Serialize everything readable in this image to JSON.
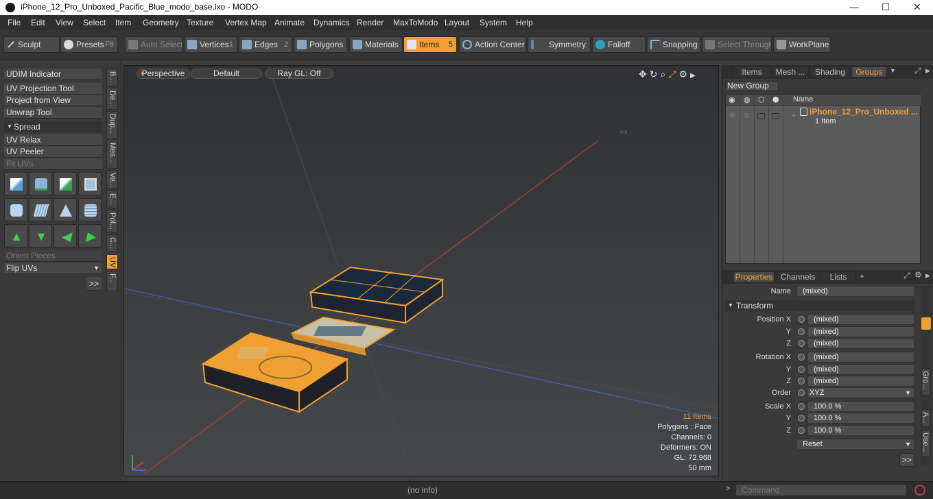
{
  "window": {
    "title": "iPhone_12_Pro_Unboxed_Pacific_Blue_modo_base.lxo - MODO",
    "minimize": "—",
    "maximize": "☐",
    "close": "✕"
  },
  "menu": [
    "File",
    "Edit",
    "View",
    "Select",
    "Item",
    "Geometry",
    "Texture",
    "Vertex Map",
    "Animate",
    "Dynamics",
    "Render",
    "MaxToModo",
    "Layout",
    "System",
    "Help"
  ],
  "toolbar": {
    "sculpt": "Sculpt",
    "presets": "Presets",
    "presets_key": "F6",
    "auto_select": "Auto Select",
    "vertices": "Vertices",
    "vertices_key": "1",
    "edges": "Edges",
    "edges_key": "2",
    "polygons": "Polygons",
    "materials": "Materials",
    "items": "Items",
    "items_key": "5",
    "action_center": "Action Center",
    "symmetry": "Symmetry",
    "falloff": "Falloff",
    "snapping": "Snapping",
    "select_through": "Select Through",
    "workplane": "WorkPlane"
  },
  "leftpanel": {
    "udim": "UDIM Indicator",
    "uv_projection": "UV Projection Tool",
    "project_from_view": "Project from View",
    "unwrap": "Unwrap Tool",
    "spread": "Spread",
    "uv_relax": "UV Relax",
    "uv_peeler": "UV Peeler",
    "fit_uvs": "Fit UVs",
    "orient_pieces": "Orient Pieces",
    "flip_uvs": "Flip UVs",
    "more": ">>",
    "vtabs": [
      "B...",
      "De...",
      "Dup...",
      "Mes...",
      "Ve...",
      "E...",
      "Pol...",
      "C...",
      "UV",
      "F..."
    ]
  },
  "viewport": {
    "view": "Perspective",
    "shading": "Default",
    "raygl": "Ray GL: Off",
    "items_count": "11 Items",
    "polygons": "Polygons : Face",
    "channels": "Channels: 0",
    "deformers": "Deformers: ON",
    "gl": "GL: 72,968",
    "lens": "50 mm"
  },
  "rightpanel": {
    "tabs": [
      "Items",
      "Mesh ...",
      "Shading",
      "Groups"
    ],
    "new_group": "New Group",
    "col_name": "Name",
    "group_name": "iPhone_12_Pro_Unboxed ...",
    "group_sub": "1 Item",
    "ptabs": [
      "Properties",
      "Channels",
      "Lists",
      "+"
    ],
    "name_label": "Name",
    "name_value": "(mixed)",
    "transform": "Transform",
    "position_x": "Position X",
    "y": "Y",
    "z": "Z",
    "rotation_x": "Rotation X",
    "order": "Order",
    "order_value": "XYZ",
    "scale_x": "Scale X",
    "mixed": "(mixed)",
    "scale_val": "100.0 %",
    "reset": "Reset",
    "more": ">>",
    "side_tabs": [
      "Gro...",
      "A...",
      "Use..."
    ]
  },
  "statusbar": {
    "info": "(no info)",
    "command_placeholder": "Command"
  },
  "colors": {
    "accent": "#f0a030",
    "background": "#3a3a3a"
  }
}
